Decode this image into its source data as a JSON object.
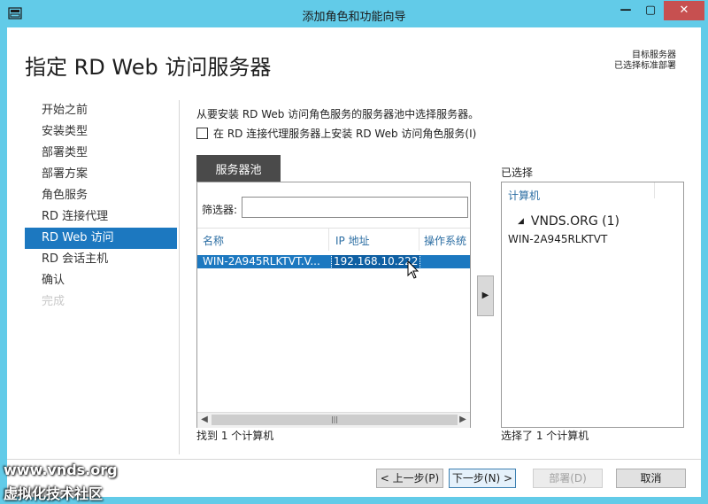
{
  "window": {
    "title": "添加角色和功能向导",
    "controls": {
      "minimize": "—",
      "maximize": "▢",
      "close": "✕"
    },
    "app_icon": "server-manager-icon"
  },
  "header": {
    "page_title": "指定 RD Web 访问服务器",
    "destination_label": "目标服务器",
    "destination_value": "已选择标准部署"
  },
  "nav": {
    "items": [
      {
        "label": "开始之前"
      },
      {
        "label": "安装类型"
      },
      {
        "label": "部署类型"
      },
      {
        "label": "部署方案"
      },
      {
        "label": "角色服务"
      },
      {
        "label": "RD 连接代理"
      },
      {
        "label": "RD Web 访问",
        "active": true
      },
      {
        "label": "RD 会话主机"
      },
      {
        "label": "确认"
      },
      {
        "label": "完成",
        "disabled": true
      }
    ]
  },
  "main": {
    "description": "从要安装 RD Web 访问角色服务的服务器池中选择服务器。",
    "install_on_broker_label": "在 RD 连接代理服务器上安装 RD Web 访问角色服务(I)",
    "install_on_broker_checked": false,
    "pool_tab": "服务器池",
    "filter_label": "筛选器:",
    "filter_value": "",
    "columns": [
      "名称",
      "IP 地址",
      "操作系统"
    ],
    "rows": [
      {
        "name": "WIN-2A945RLKTVT.V...",
        "ip": "192.168.10.222",
        "os": "",
        "selected": true
      }
    ],
    "scroll_thumb_glyph": "|||",
    "found_text": "找到 1 个计算机",
    "move_button_glyph": "▶"
  },
  "selected": {
    "label": "已选择",
    "column": "计算机",
    "group": "VNDS.ORG (1)",
    "items": [
      "WIN-2A945RLKTVT"
    ],
    "count_text": "选择了 1 个计算机"
  },
  "footer": {
    "prev": "< 上一步(P)",
    "next": "下一步(N) >",
    "deploy": "部署(D)",
    "cancel": "取消"
  },
  "watermark": {
    "line1": "www.vnds.org",
    "line2": "虚拟化技术社区"
  },
  "colors": {
    "titlebar": "#62cbe8",
    "nav_active": "#1c78c0",
    "header_link": "#2c6ea3",
    "close_button": "#c75050"
  }
}
